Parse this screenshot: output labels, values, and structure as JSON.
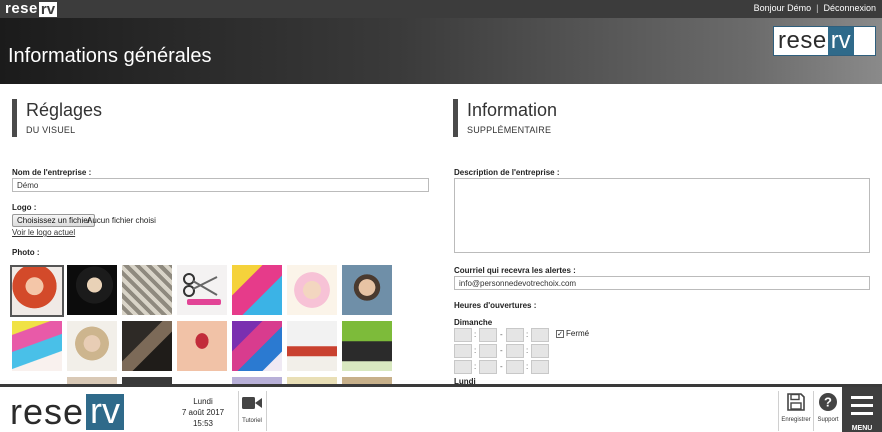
{
  "topbar": {
    "logo_word": "rese",
    "logo_box": "rv",
    "greeting": "Bonjour Démo",
    "separator": "|",
    "logout": "Déconnexion"
  },
  "header": {
    "title": "Informations générales",
    "logo_word": "rese",
    "logo_box": "rv"
  },
  "left": {
    "heading": "Réglages",
    "subheading": "DU VISUEL",
    "company_label": "Nom de l'entreprise :",
    "company_value": "Démo",
    "logo_label": "Logo :",
    "file_button": "Choisissez un fichier",
    "file_none": "Aucun fichier choisi",
    "logo_link": "Voir le logo actuel",
    "photo_label": "Photo :"
  },
  "right": {
    "heading": "Information",
    "subheading": "SUPPLÉMENTAIRE",
    "description_label": "Description de l'entreprise :",
    "email_label": "Courriel qui recevra les alertes :",
    "email_value": "info@personnedevotrechoix.com",
    "hours_label": "Heures d'ouvertures :",
    "day1": "Dimanche",
    "closed_label": "Fermé",
    "day2": "Lundi",
    "hour_sep_dash": "-",
    "hour_sep_colon": ":"
  },
  "bottom": {
    "logo_word": "rese",
    "logo_box": "rv",
    "weekday": "Lundi",
    "date": "7 août 2017",
    "time": "15:53",
    "tutorial": "Tutoriel",
    "save": "Enregistrer",
    "support": "Support",
    "menu": "MENU"
  },
  "colors": {
    "brand_blue": "#2f6a8a",
    "dark_bar": "#3c3c3c"
  },
  "photos": [
    {
      "name": "photo-red-hair-woman"
    },
    {
      "name": "photo-mask-woman"
    },
    {
      "name": "photo-curly-blonde"
    },
    {
      "name": "photo-scissors-tools"
    },
    {
      "name": "photo-colorful-makeup"
    },
    {
      "name": "photo-flower-girl"
    },
    {
      "name": "photo-man-portrait"
    },
    {
      "name": "photo-rainbow-makeup"
    },
    {
      "name": "photo-blonde-updo"
    },
    {
      "name": "photo-barber-tools"
    },
    {
      "name": "photo-lips-hands"
    },
    {
      "name": "photo-nail-polish"
    },
    {
      "name": "photo-spa-towels"
    },
    {
      "name": "photo-spa-stones"
    }
  ]
}
